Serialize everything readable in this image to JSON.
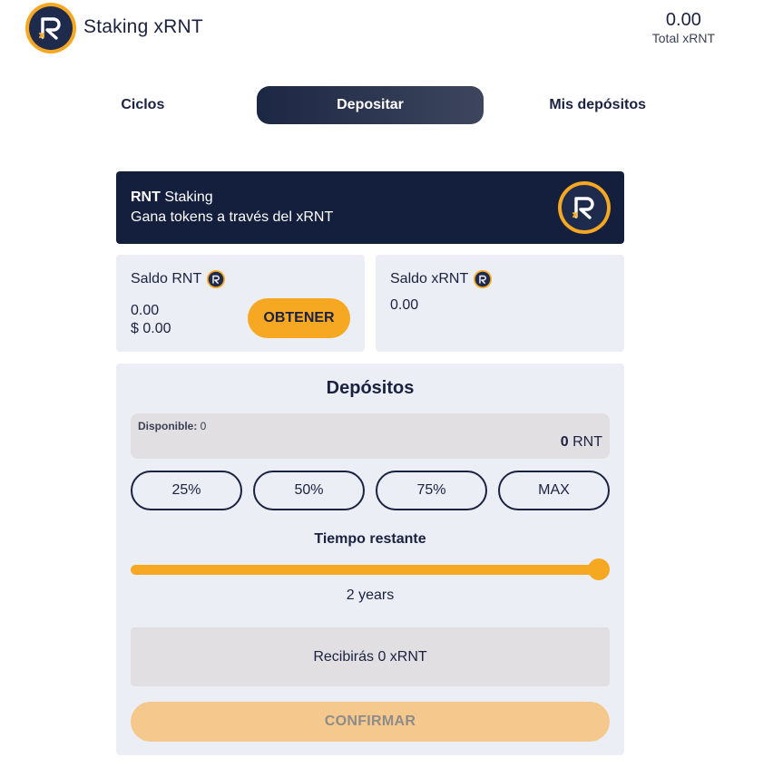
{
  "header": {
    "title": "Staking xRNT",
    "total_value": "0.00",
    "total_label": "Total xRNT"
  },
  "tabs": [
    {
      "label": "Ciclos",
      "active": false
    },
    {
      "label": "Depositar",
      "active": true
    },
    {
      "label": "Mis depósitos",
      "active": false
    }
  ],
  "banner": {
    "title_bold": "RNT",
    "title_rest": " Staking",
    "subtitle": "Gana tokens a través del xRNT"
  },
  "balances": {
    "rnt": {
      "label": "Saldo RNT",
      "amount": "0.00",
      "usd": "$ 0.00",
      "button": "OBTENER"
    },
    "xrnt": {
      "label": "Saldo xRNT",
      "amount": "0.00"
    }
  },
  "deposit": {
    "title": "Depósitos",
    "available_label": "Disponible:",
    "available_value": " 0",
    "amount_value": "0",
    "amount_unit": " RNT",
    "percent_buttons": [
      "25%",
      "50%",
      "75%",
      "MAX"
    ],
    "time_label": "Tiempo restante",
    "time_value": "2 years",
    "slider_level": 1.0,
    "receive_text": "Recibirás 0 xRNT",
    "confirm_label": "CONFIRMAR"
  },
  "colors": {
    "accent": "#f7a823",
    "dark": "#141e3d",
    "panel": "#ebeef4",
    "confirm_disabled": "#f5c88d"
  },
  "icons": {
    "logo": "rnt-logo-icon"
  }
}
